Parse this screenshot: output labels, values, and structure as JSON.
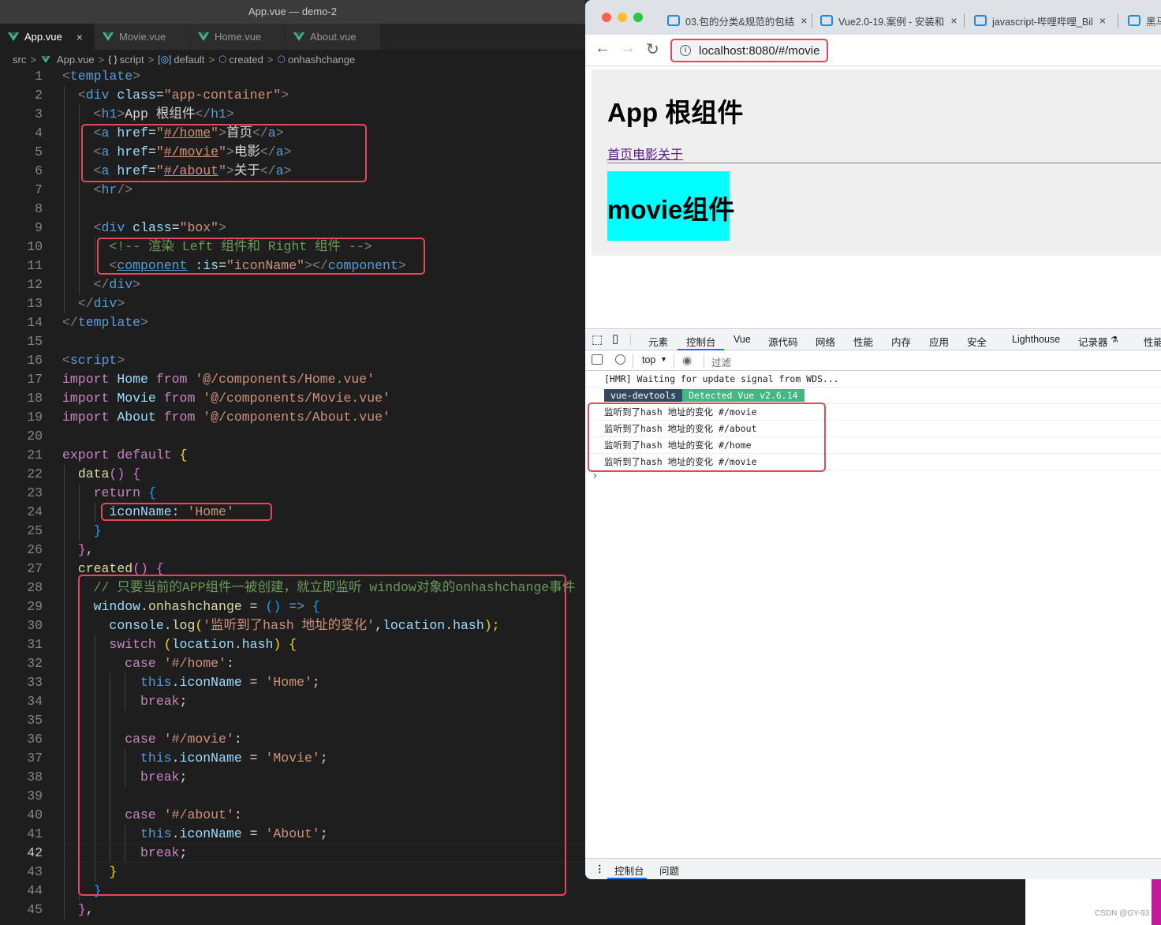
{
  "editor": {
    "title": "App.vue — demo-2",
    "tabs": [
      {
        "label": "App.vue",
        "close": "×"
      },
      {
        "label": "Movie.vue"
      },
      {
        "label": "Home.vue"
      },
      {
        "label": "About.vue"
      }
    ],
    "breadcrumbs": {
      "src": "src",
      "file": "App.vue",
      "script_icon": "{ }",
      "script": "script",
      "default_icon": "[◎]",
      "default": "default",
      "created": "created",
      "onhashchange": "onhashchange",
      "separator": ">"
    },
    "line_numbers": [
      "1",
      "2",
      "3",
      "4",
      "5",
      "6",
      "7",
      "8",
      "9",
      "10",
      "11",
      "12",
      "13",
      "14",
      "15",
      "16",
      "17",
      "18",
      "19",
      "20",
      "21",
      "22",
      "23",
      "24",
      "25",
      "26",
      "27",
      "28",
      "29",
      "30",
      "31",
      "32",
      "33",
      "34",
      "35",
      "36",
      "37",
      "38",
      "39",
      "40",
      "41",
      "42",
      "43",
      "44",
      "45"
    ],
    "current_line": "42",
    "code": {
      "l1": [
        "<",
        "template",
        ">"
      ],
      "l2": [
        "<",
        "div",
        "class",
        "=",
        "\"app-container\"",
        ">"
      ],
      "l3": [
        "<",
        "h1",
        ">",
        "App 根组件",
        "</",
        "h1",
        ">"
      ],
      "l4": [
        "<",
        "a",
        "href",
        "=",
        "\"",
        "#/home",
        "\"",
        ">",
        "首页",
        "</",
        "a",
        ">"
      ],
      "l5": [
        "<",
        "a",
        "href",
        "=",
        "\"",
        "#/movie",
        "\"",
        ">",
        "电影",
        "</",
        "a",
        ">"
      ],
      "l6": [
        "<",
        "a",
        "href",
        "=",
        "\"",
        "#/about",
        "\"",
        ">",
        "关于",
        "</",
        "a",
        ">"
      ],
      "l7": [
        "<",
        "hr",
        "/>"
      ],
      "l9": [
        "<",
        "div",
        "class",
        "=",
        "\"box\"",
        ">"
      ],
      "l10": "<!-- 渲染 Left 组件和 Right 组件 -->",
      "l11": [
        "<",
        "component",
        ":is",
        "=",
        "\"iconName\"",
        "></",
        "component",
        ">"
      ],
      "l12": [
        "</",
        "div",
        ">"
      ],
      "l13": [
        "</",
        "div",
        ">"
      ],
      "l14": [
        "</",
        "template",
        ">"
      ],
      "l16": [
        "<",
        "script",
        ">"
      ],
      "l17": [
        "import",
        "Home",
        "from",
        "'@/components/Home.vue'"
      ],
      "l18": [
        "import",
        "Movie",
        "from",
        "'@/components/Movie.vue'"
      ],
      "l19": [
        "import",
        "About",
        "from",
        "'@/components/About.vue'"
      ],
      "l21": [
        "export",
        "default",
        "{"
      ],
      "l22": [
        "data",
        "()",
        "{"
      ],
      "l23": [
        "return",
        "{"
      ],
      "l24": [
        "iconName",
        ":",
        "'Home'"
      ],
      "l25": "}",
      "l26": [
        "}",
        ","
      ],
      "l27": [
        "created",
        "()",
        "{"
      ],
      "l28": "// 只要当前的APP组件一被创建，就立即监听 window对象的onhashchange事件",
      "l29": [
        "window",
        ".",
        "onhashchange",
        "=",
        "()",
        "=>",
        "{"
      ],
      "l30": [
        "console",
        ".",
        "log",
        "(",
        "'监听到了hash 地址的变化'",
        ",",
        "location",
        ".",
        "hash",
        ");"
      ],
      "l31": [
        "switch",
        "(",
        "location",
        ".",
        "hash",
        ")",
        "{"
      ],
      "l32": [
        "case",
        "'#/home'",
        ":"
      ],
      "l33": [
        "this",
        ".",
        "iconName",
        "=",
        "'Home'",
        ";"
      ],
      "l34": [
        "break",
        ";"
      ],
      "l36": [
        "case",
        "'#/movie'",
        ":"
      ],
      "l37": [
        "this",
        ".",
        "iconName",
        "=",
        "'Movie'",
        ";"
      ],
      "l38": [
        "break",
        ";"
      ],
      "l40": [
        "case",
        "'#/about'",
        ":"
      ],
      "l41": [
        "this",
        ".",
        "iconName",
        "=",
        "'About'",
        ";"
      ],
      "l42": [
        "break",
        ";"
      ],
      "l43": "}",
      "l44": "}",
      "l45": [
        "}",
        ","
      ]
    }
  },
  "browser": {
    "tabs": [
      {
        "title": "03.包的分类&规范的包结",
        "close": "×"
      },
      {
        "title": "Vue2.0-19.案例 - 安装和",
        "close": "×"
      },
      {
        "title": "javascript-哔哩哔哩_Bil",
        "close": "×"
      },
      {
        "title": "黑马"
      }
    ],
    "url": "localhost:8080/#/movie",
    "info_icon": "i",
    "nav": {
      "back": "←",
      "forward": "→",
      "reload": "↻"
    },
    "page": {
      "h1": "App 根组件",
      "links": [
        "首页",
        "电影",
        "关于"
      ],
      "movie_h1": "movie组件",
      "movie_bg": "#00ffff"
    },
    "devtools": {
      "tabs": [
        "元素",
        "控制台",
        "Vue",
        "源代码",
        "网络",
        "性能",
        "内存",
        "应用",
        "安全",
        "Lighthouse",
        "记录器",
        "性能"
      ],
      "recorder_icon": "⚗",
      "context": "top",
      "context_arrow": "▼",
      "filter_placeholder": "过滤",
      "console_lines": [
        "[HMR] Waiting for update signal from WDS...",
        "监听到了hash 地址的变化 #/movie",
        "监听到了hash 地址的变化 #/about",
        "监听到了hash 地址的变化 #/home",
        "监听到了hash 地址的变化 #/movie"
      ],
      "devtools_badge": "vue-devtools",
      "detected_badge": "Detected Vue v2.6.14",
      "prompt": "›",
      "bottom_tabs": [
        "控制台",
        "问题"
      ],
      "kebab": "⋮"
    }
  },
  "watermark": "CSDN @GY-93",
  "colors": {
    "highlight_box": "#e4475a",
    "vue_green": "#41b883",
    "vue_dark": "#35495e"
  }
}
